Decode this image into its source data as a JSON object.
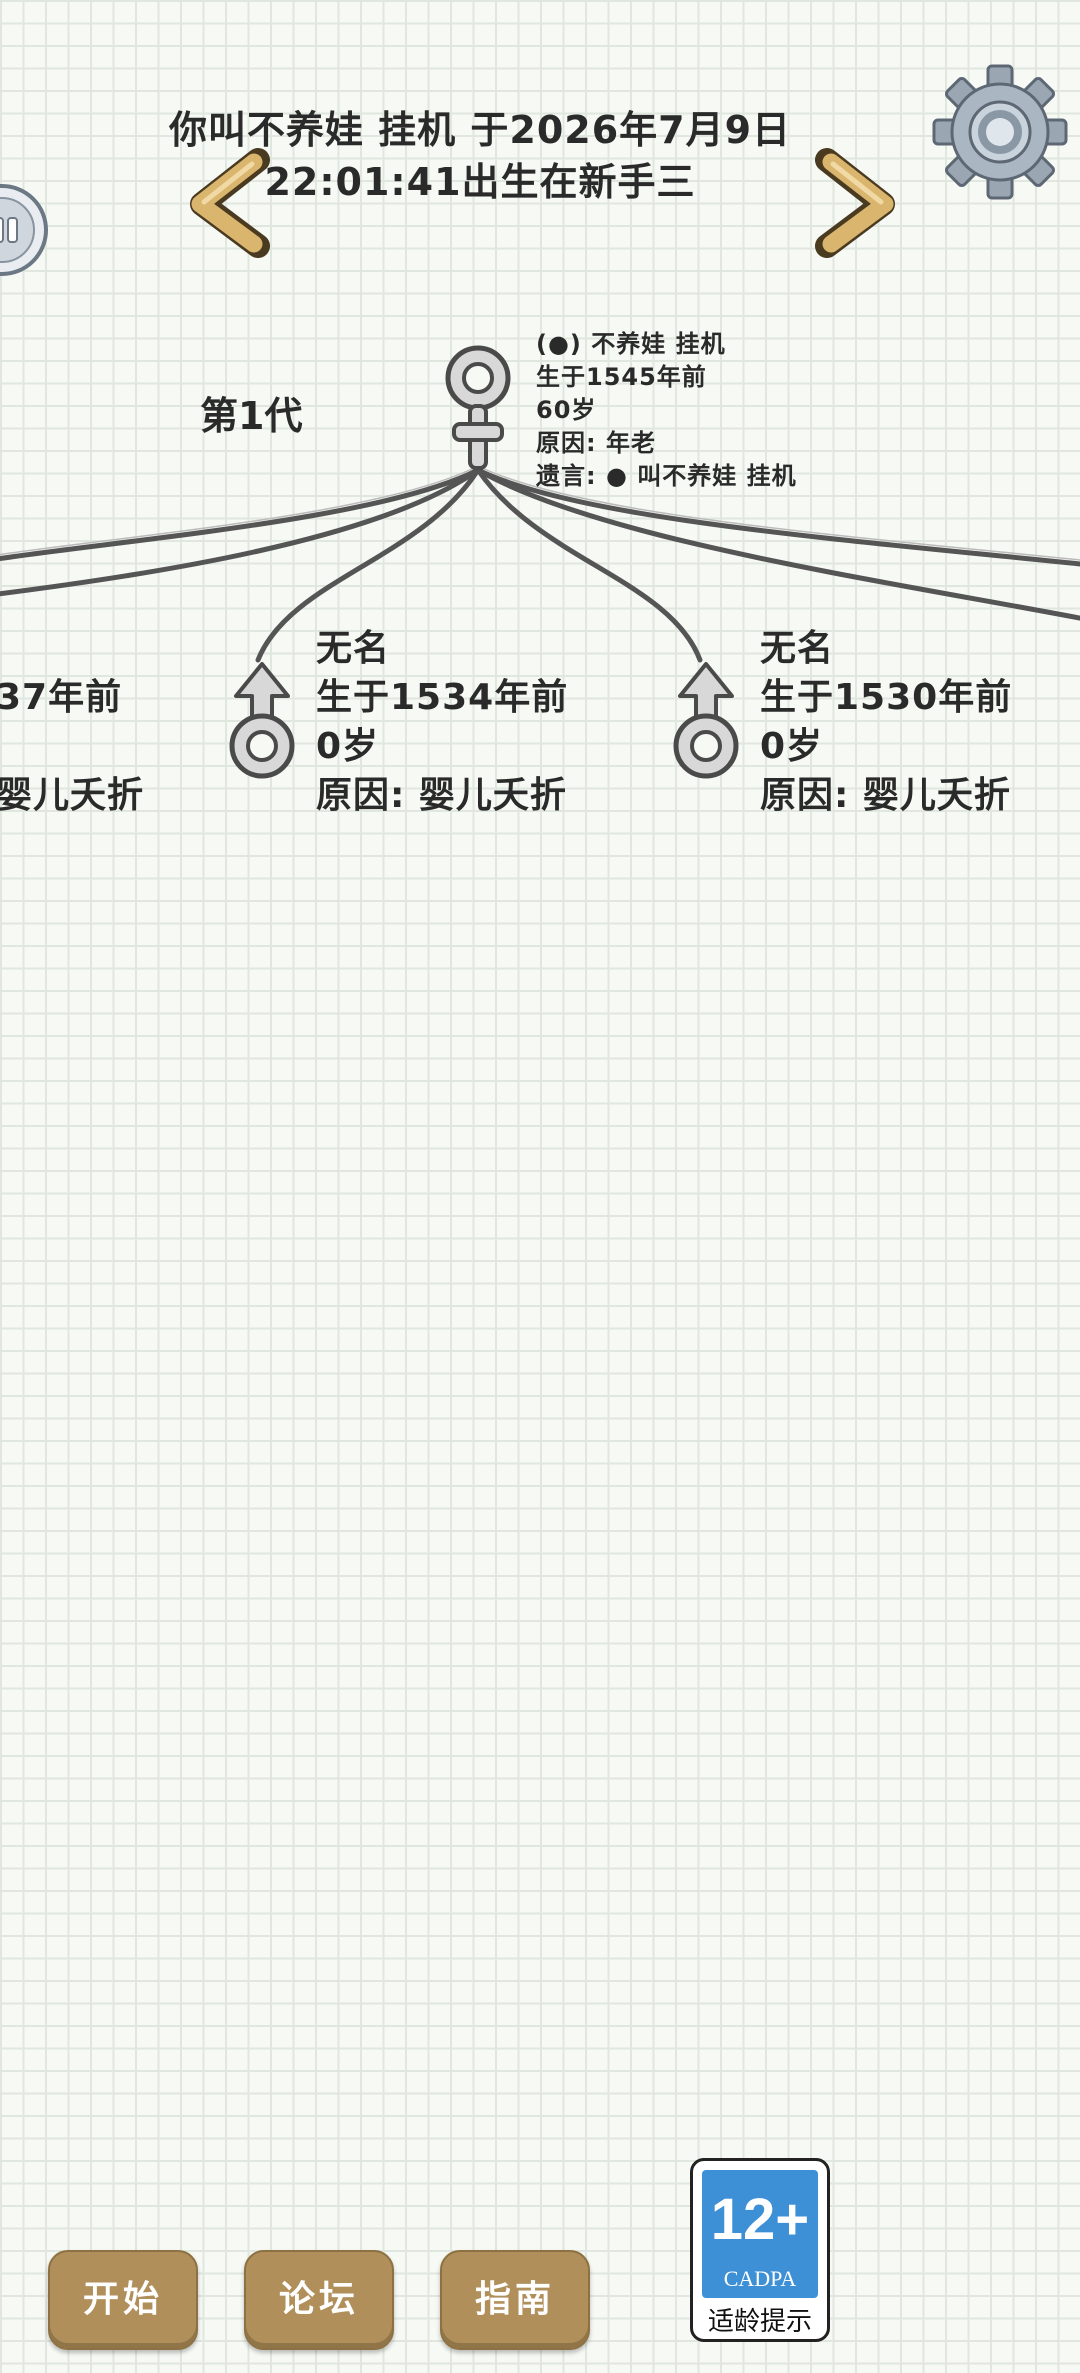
{
  "header": {
    "title_line1": "你叫不养娃 挂机 于2026年7月9日",
    "title_line2": "22:01:41出生在新手三"
  },
  "generation": {
    "label": "第1代"
  },
  "ancestor": {
    "name": "(●) 不养娃 挂机",
    "born": "生于1545年前",
    "age": "60岁",
    "cause": "原因: 年老",
    "will": "遗言: ● 叫不养娃 挂机",
    "gender": "female"
  },
  "children": [
    {
      "name": "",
      "born": "37年前",
      "age": "",
      "cause": "婴儿夭折",
      "gender": "male"
    },
    {
      "name": "无名",
      "born": "生于1534年前",
      "age": "0岁",
      "cause": "原因: 婴儿夭折",
      "gender": "male"
    },
    {
      "name": "无名",
      "born": "生于1530年前",
      "age": "0岁",
      "cause": "原因: 婴儿夭折",
      "gender": "male"
    }
  ],
  "bottom_nav": {
    "start": "开始",
    "forum": "论坛",
    "guide": "指南"
  },
  "age_rating": {
    "number": "12+",
    "org": "CADPA",
    "label": "适龄提示"
  },
  "colors": {
    "paper": "#f7f9f5",
    "grid": "#dfe7de",
    "button": "#b08f5a",
    "arrow": "#d9b56d",
    "badge": "#3d8fd6"
  }
}
